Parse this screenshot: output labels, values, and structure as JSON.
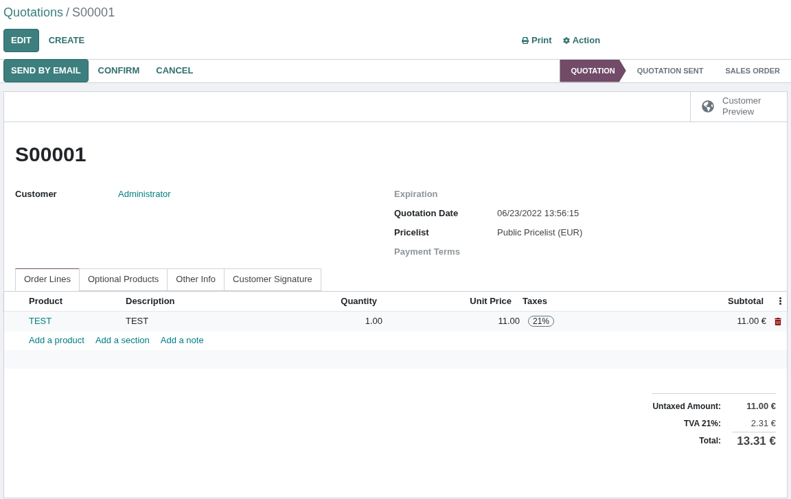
{
  "breadcrumb": {
    "parent": "Quotations",
    "separator": "/",
    "current": "S00001"
  },
  "control_buttons": [
    {
      "label": "EDIT",
      "kind": "primary"
    },
    {
      "label": "CREATE",
      "kind": "link"
    }
  ],
  "actions": [
    {
      "label": "Print",
      "kind": "print"
    },
    {
      "label": "Action",
      "kind": "gear"
    }
  ],
  "header_buttons": [
    {
      "label": "SEND BY EMAIL",
      "kind": "primary"
    },
    {
      "label": "CONFIRM",
      "kind": "link"
    },
    {
      "label": "CANCEL",
      "kind": "link"
    }
  ],
  "stages": [
    {
      "label": "QUOTATION",
      "selected": true
    },
    {
      "label": "QUOTATION SENT",
      "selected": false
    },
    {
      "label": "SALES ORDER",
      "selected": false
    }
  ],
  "smart_button": {
    "label": "Customer Preview"
  },
  "title": "S00001",
  "left_fields": [
    {
      "label": "Customer",
      "value": "Administrator",
      "kind": "link"
    }
  ],
  "right_fields": [
    {
      "label": "Expiration"
    },
    {
      "label": "Quotation Date",
      "value": "06/23/2022 13:56:15",
      "kind": "text"
    },
    {
      "label": "Pricelist",
      "value": "Public Pricelist (EUR)",
      "kind": "text"
    },
    {
      "label": "Payment Terms"
    }
  ],
  "tabs": [
    {
      "label": "Order Lines",
      "selected": true
    },
    {
      "label": "Optional Products",
      "selected": false
    },
    {
      "label": "Other Info",
      "selected": false
    },
    {
      "label": "Customer Signature",
      "selected": false
    }
  ],
  "table": {
    "columns": [
      "Product",
      "Description",
      "Quantity",
      "Unit Price",
      "Taxes",
      "Subtotal"
    ],
    "rows": [
      {
        "product": "TEST",
        "description": "TEST",
        "quantity": "1.00",
        "unit_price": "11.00",
        "taxes": "21%",
        "subtotal": "11.00 €"
      }
    ],
    "add_links": [
      "Add a product",
      "Add a section",
      "Add a note"
    ]
  },
  "totals": [
    {
      "label": "Untaxed Amount:",
      "value": "11.00 €",
      "kind": "bold"
    },
    {
      "label": "TVA 21%:",
      "value": "2.31 €",
      "kind": "normal"
    },
    {
      "label": "Total:",
      "value": "13.31 €",
      "kind": "grand"
    }
  ]
}
